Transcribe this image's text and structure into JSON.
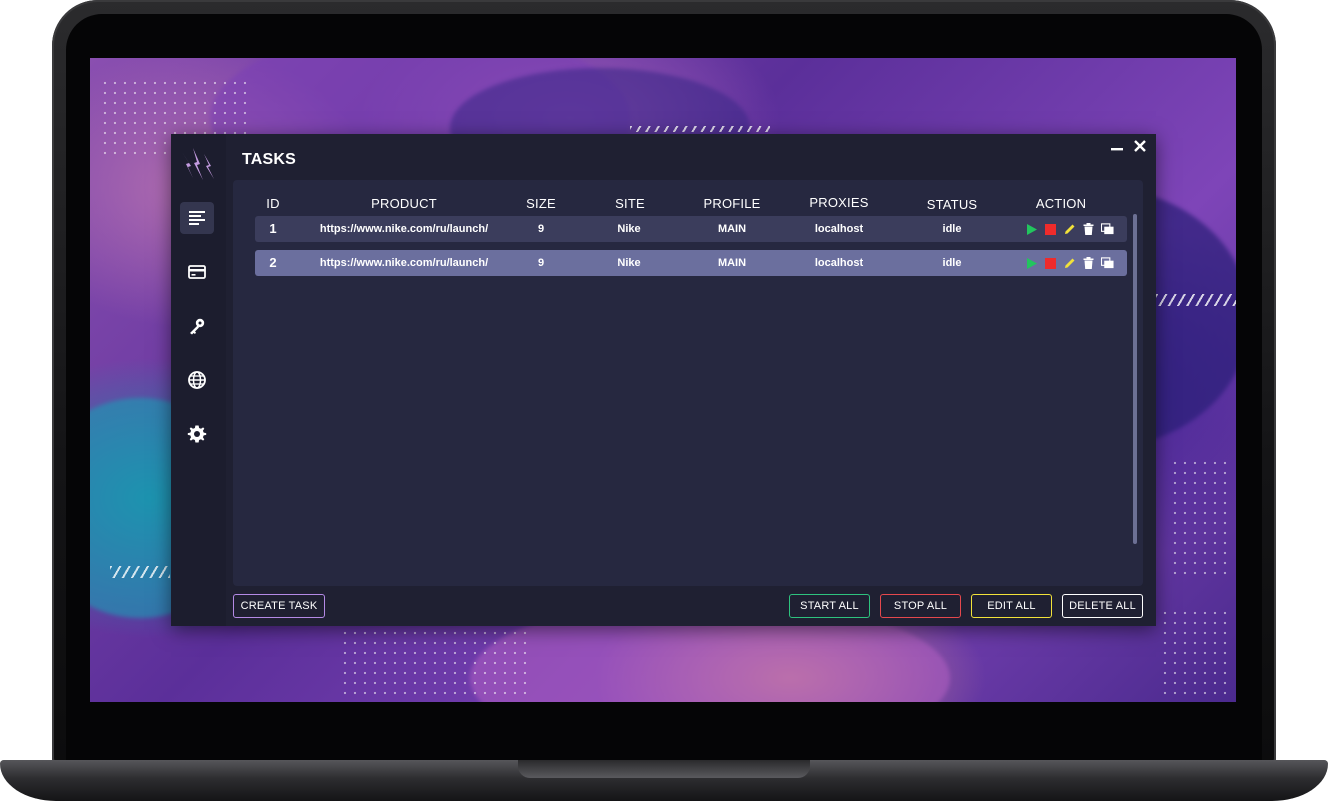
{
  "window": {
    "title": "TASKS",
    "minimize_icon": "minimize-icon",
    "close_icon": "close-icon"
  },
  "sidebar": {
    "logo": "bolt-claw-logo",
    "items": [
      {
        "name": "tasks",
        "icon": "list-icon",
        "active": true
      },
      {
        "name": "billing",
        "icon": "credit-card-icon",
        "active": false
      },
      {
        "name": "key",
        "icon": "key-icon",
        "active": false
      },
      {
        "name": "proxies",
        "icon": "globe-icon",
        "active": false
      },
      {
        "name": "settings",
        "icon": "gear-icon",
        "active": false
      }
    ]
  },
  "table": {
    "columns": [
      "ID",
      "PRODUCT",
      "SIZE",
      "SITE",
      "PROFILE",
      "PROXIES",
      "STATUS",
      "ACTION"
    ],
    "rows": [
      {
        "id": "1",
        "product": "https://www.nike.com/ru/launch/",
        "size": "9",
        "site": "Nike",
        "profile": "MAIN",
        "proxies": "localhost",
        "status": "idle"
      },
      {
        "id": "2",
        "product": "https://www.nike.com/ru/launch/",
        "size": "9",
        "site": "Nike",
        "profile": "MAIN",
        "proxies": "localhost",
        "status": "idle"
      }
    ],
    "row_actions": [
      "play-icon",
      "stop-icon",
      "edit-icon",
      "trash-icon",
      "copy-icon"
    ],
    "action_colors": {
      "play": "#22c55e",
      "stop": "#ef2b2b",
      "edit": "#f2e23a",
      "delete": "#ffffff",
      "copy": "#ffffff"
    }
  },
  "buttons": {
    "create_task": "CREATE TASK",
    "start_all": "START ALL",
    "stop_all": "STOP ALL",
    "edit_all": "EDIT ALL",
    "delete_all": "DELETE ALL"
  },
  "colors": {
    "create": "#b48ae6",
    "start": "#2ec27e",
    "stop": "#e5484d",
    "edit": "#f2e23a",
    "delete": "#ffffff"
  }
}
